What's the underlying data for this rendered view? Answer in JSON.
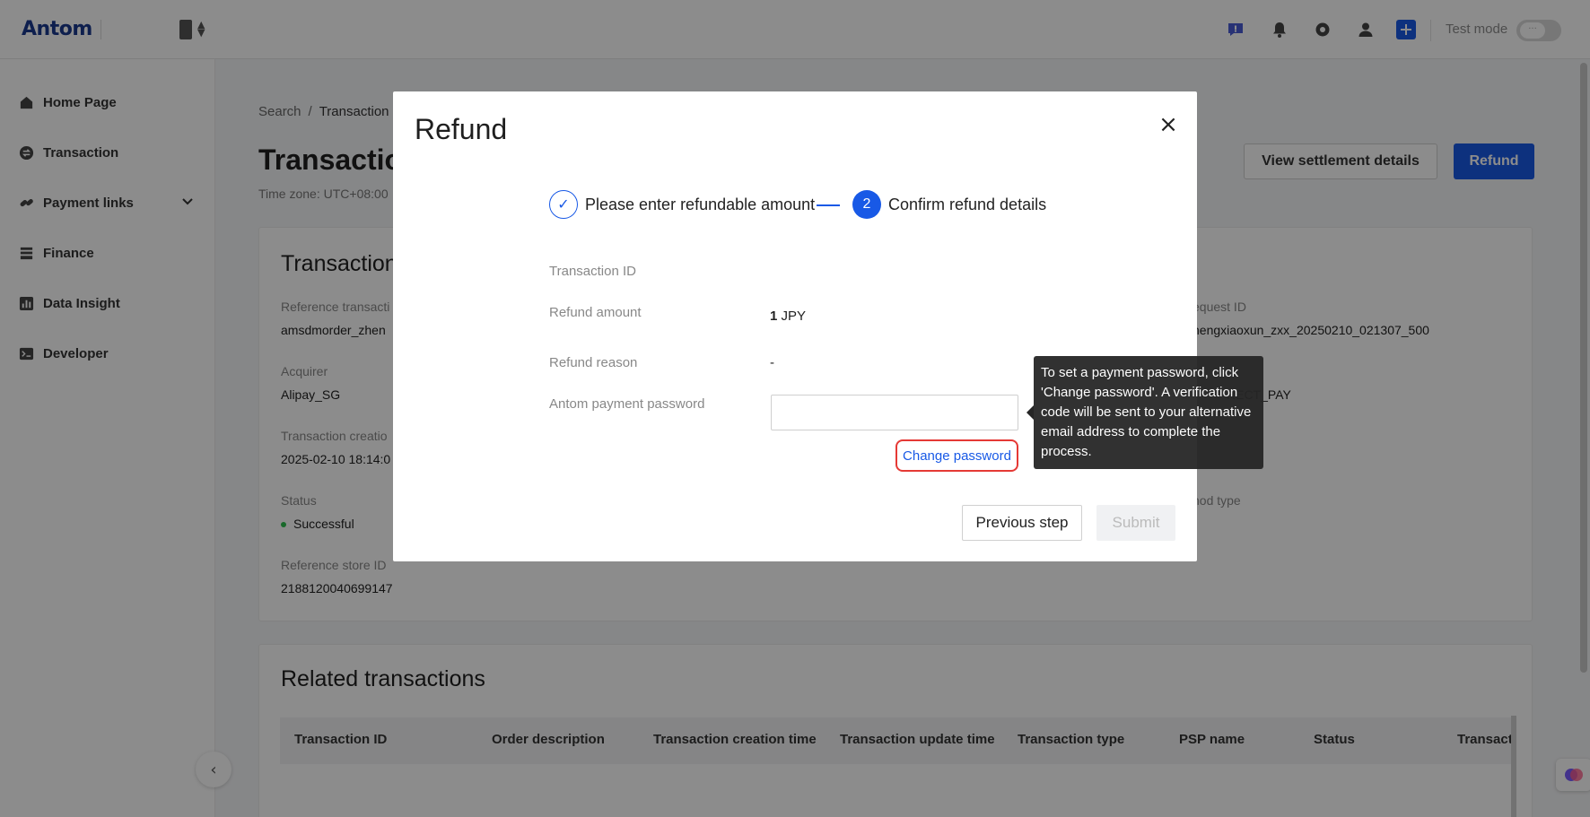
{
  "header": {
    "logo": "Antom",
    "test_mode_label": "Test mode",
    "icons": [
      "feedback-icon",
      "bell-icon",
      "gear-icon",
      "user-icon",
      "plus-icon"
    ]
  },
  "sidebar": {
    "items": [
      {
        "label": "Home Page",
        "icon": "home-icon"
      },
      {
        "label": "Transaction",
        "icon": "transaction-icon"
      },
      {
        "label": "Payment links",
        "icon": "link-icon"
      },
      {
        "label": "Finance",
        "icon": "finance-icon"
      },
      {
        "label": "Data Insight",
        "icon": "chart-icon"
      },
      {
        "label": "Developer",
        "icon": "terminal-icon"
      }
    ],
    "collapse_glyph": "‹"
  },
  "page": {
    "breadcrumb": {
      "root": "Search",
      "separator": "/",
      "current": "Transaction d"
    },
    "title": "Transactio",
    "timezone": "Time zone: UTC+08:00",
    "view_settlement_label": "View settlement details",
    "refund_label": "Refund"
  },
  "details": {
    "title": "Transaction",
    "reference_transaction_label": "Reference transacti",
    "reference_transaction_value": "amsdmorder_zhen",
    "request_id_label": "equest ID",
    "request_id_value": "hengxiaoxun_zxx_20250210_021307_500",
    "acquirer_label": "Acquirer",
    "acquirer_value": "Alipay_SG",
    "product_value": "RECT_PAY",
    "creation_label": "Transaction creatio",
    "creation_value": "2025-02-10 18:14:0",
    "status_label": "Status",
    "status_value": "Successful",
    "method_type_label": "hod type",
    "store_id_label": "Reference store ID",
    "store_id_value": "2188120040699147"
  },
  "related": {
    "title": "Related transactions",
    "columns": [
      "Transaction ID",
      "Order description",
      "Transaction creation time",
      "Transaction update time",
      "Transaction type",
      "PSP name",
      "Status",
      "Transact"
    ]
  },
  "modal": {
    "title": "Refund",
    "close_glyph": "×",
    "steps": [
      {
        "number": "✓",
        "label": "Please enter refundable amount",
        "state": "done"
      },
      {
        "number": "2",
        "label": "Confirm refund details",
        "state": "active"
      }
    ],
    "transaction_id_label": "Transaction ID",
    "transaction_id_value": "",
    "refund_amount_label": "Refund amount",
    "refund_amount_number": "1",
    "refund_amount_currency": "JPY",
    "refund_reason_label": "Refund reason",
    "refund_reason_value": "-",
    "password_label": "Antom payment password",
    "password_value": "",
    "change_password_label": "Change password",
    "previous_label": "Previous step",
    "submit_label": "Submit",
    "tooltip": "To set a payment password, click 'Change password'. A verification code will be sent to your alternative email address to complete the process."
  },
  "colors": {
    "primary": "#1859e6",
    "highlight": "#e53935",
    "success": "#2fbf4f"
  }
}
